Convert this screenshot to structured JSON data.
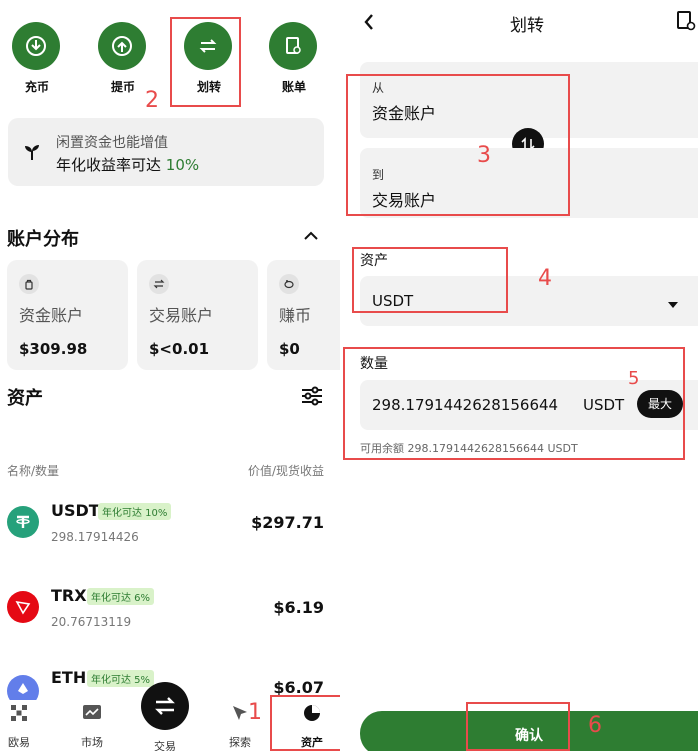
{
  "left": {
    "quick_actions": [
      {
        "label": "充币",
        "icon": "deposit-icon"
      },
      {
        "label": "提币",
        "icon": "withdraw-icon"
      },
      {
        "label": "划转",
        "icon": "transfer-icon"
      },
      {
        "label": "账单",
        "icon": "bill-icon"
      }
    ],
    "promo": {
      "line1": "闲置资金也能增值",
      "line2_prefix": "年化收益率可达 ",
      "line2_highlight": "10%"
    },
    "account_distribution": {
      "title": "账户分布",
      "cards": [
        {
          "name": "资金账户",
          "value": "$309.98",
          "icon": "wallet-icon"
        },
        {
          "name": "交易账户",
          "value": "$<0.01",
          "icon": "swap-icon"
        },
        {
          "name": "赚币",
          "value": "$0",
          "icon": "piggy-icon"
        }
      ]
    },
    "assets": {
      "title": "资产",
      "col_left": "名称/数量",
      "col_right": "价值/现货收益",
      "rows": [
        {
          "symbol": "USDT",
          "badge": "年化可达 10%",
          "amount": "298.17914426",
          "value": "$297.71",
          "color": "#26a17b"
        },
        {
          "symbol": "TRX",
          "badge": "年化可达 6%",
          "amount": "20.76713119",
          "value": "$6.19",
          "color": "#e50914"
        },
        {
          "symbol": "ETH",
          "badge": "年化可达 5%",
          "amount": "",
          "value": "$6.07",
          "color": "#627eea"
        }
      ]
    },
    "bottom_nav": [
      {
        "label": "欧易",
        "icon": "home-icon"
      },
      {
        "label": "市场",
        "icon": "chart-icon"
      },
      {
        "label": "交易",
        "icon": "trade-icon"
      },
      {
        "label": "探索",
        "icon": "explore-icon"
      },
      {
        "label": "资产",
        "icon": "assets-icon"
      }
    ]
  },
  "right": {
    "title": "划转",
    "from_label": "从",
    "from_value": "资金账户",
    "to_label": "到",
    "to_value": "交易账户",
    "asset_label": "资产",
    "asset_value": "USDT",
    "amount_label": "数量",
    "amount_value": "298.1791442628156644",
    "amount_unit": "USDT",
    "max_label": "最大",
    "available": "可用余额 298.1791442628156644 USDT",
    "confirm_label": "确认"
  },
  "annotations": [
    "1",
    "2",
    "3",
    "4",
    "5",
    "6"
  ],
  "colors": {
    "brand_green": "#2e7d32",
    "annotation_red": "#e84b4b",
    "badge_bg": "#d9f2c9"
  }
}
